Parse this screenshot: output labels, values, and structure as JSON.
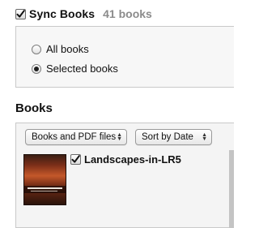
{
  "sync": {
    "checkbox_checked": true,
    "title": "Sync Books",
    "count": "41 books"
  },
  "options": {
    "items": [
      {
        "label": "All books",
        "selected": false
      },
      {
        "label": "Selected books",
        "selected": true
      }
    ]
  },
  "books": {
    "heading": "Books",
    "filter_popup": "Books and PDF files",
    "sort_popup": "Sort by Date",
    "list": [
      {
        "title": "Landscapes-in-LR5",
        "checked": true,
        "cover_icon": "book-cover-image"
      }
    ]
  },
  "colors": {
    "count_gray": "#8b8b8b",
    "panel_background": "#f4f4f4",
    "border": "#c9c9c9"
  }
}
